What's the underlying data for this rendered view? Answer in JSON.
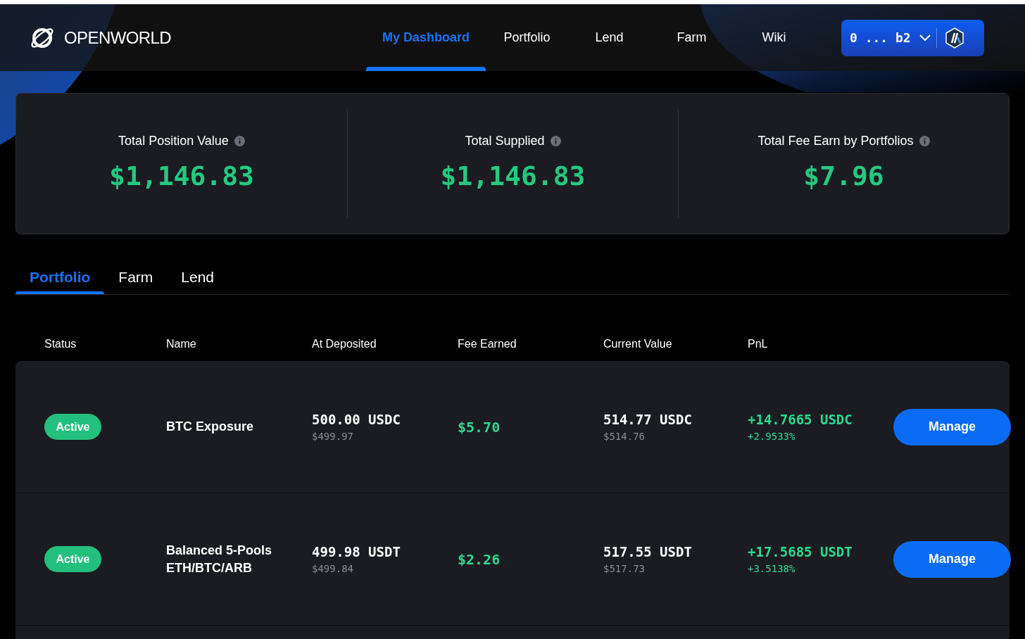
{
  "header": {
    "logo": "**OPEN**WORLD",
    "nav": [
      {
        "label": "My Dashboard",
        "selected": true
      },
      {
        "label": "Portfolio",
        "selected": false
      },
      {
        "label": "Lend",
        "selected": false
      },
      {
        "label": "Farm",
        "selected": false
      },
      {
        "label": "Wiki",
        "selected": false
      }
    ],
    "wallet": {
      "address": "0 ... b2"
    }
  },
  "stats": [
    {
      "label": "Total Position Value",
      "value": "$1,146.83"
    },
    {
      "label": "Total Supplied",
      "value": "$1,146.83"
    },
    {
      "label": "Total Fee Earn by Portfolios",
      "value": "$7.96"
    }
  ],
  "tabs": [
    {
      "label": "Portfolio",
      "selected": true
    },
    {
      "label": "Farm",
      "selected": false
    },
    {
      "label": "Lend",
      "selected": false
    }
  ],
  "table": {
    "columns": [
      "Status",
      "Name",
      "At Deposited",
      "Fee Earned",
      "Current Value",
      "PnL"
    ],
    "rows": [
      {
        "status": "Active",
        "name": "BTC Exposure",
        "deposited": "500.00 USDC",
        "deposited_usd": "$499.97",
        "fee": "$5.70",
        "current": "514.77 USDC",
        "current_usd": "$514.76",
        "pnl": "+14.7665 USDC",
        "pnl_pct": "+2.9533%",
        "action": "Manage"
      },
      {
        "status": "Active",
        "name": "Balanced 5-Pools ETH/BTC/ARB",
        "deposited": "499.98 USDT",
        "deposited_usd": "$499.84",
        "fee": "$2.26",
        "current": "517.55 USDT",
        "current_usd": "$517.73",
        "pnl": "+17.5685 USDT",
        "pnl_pct": "+3.5138%",
        "action": "Manage"
      }
    ]
  }
}
